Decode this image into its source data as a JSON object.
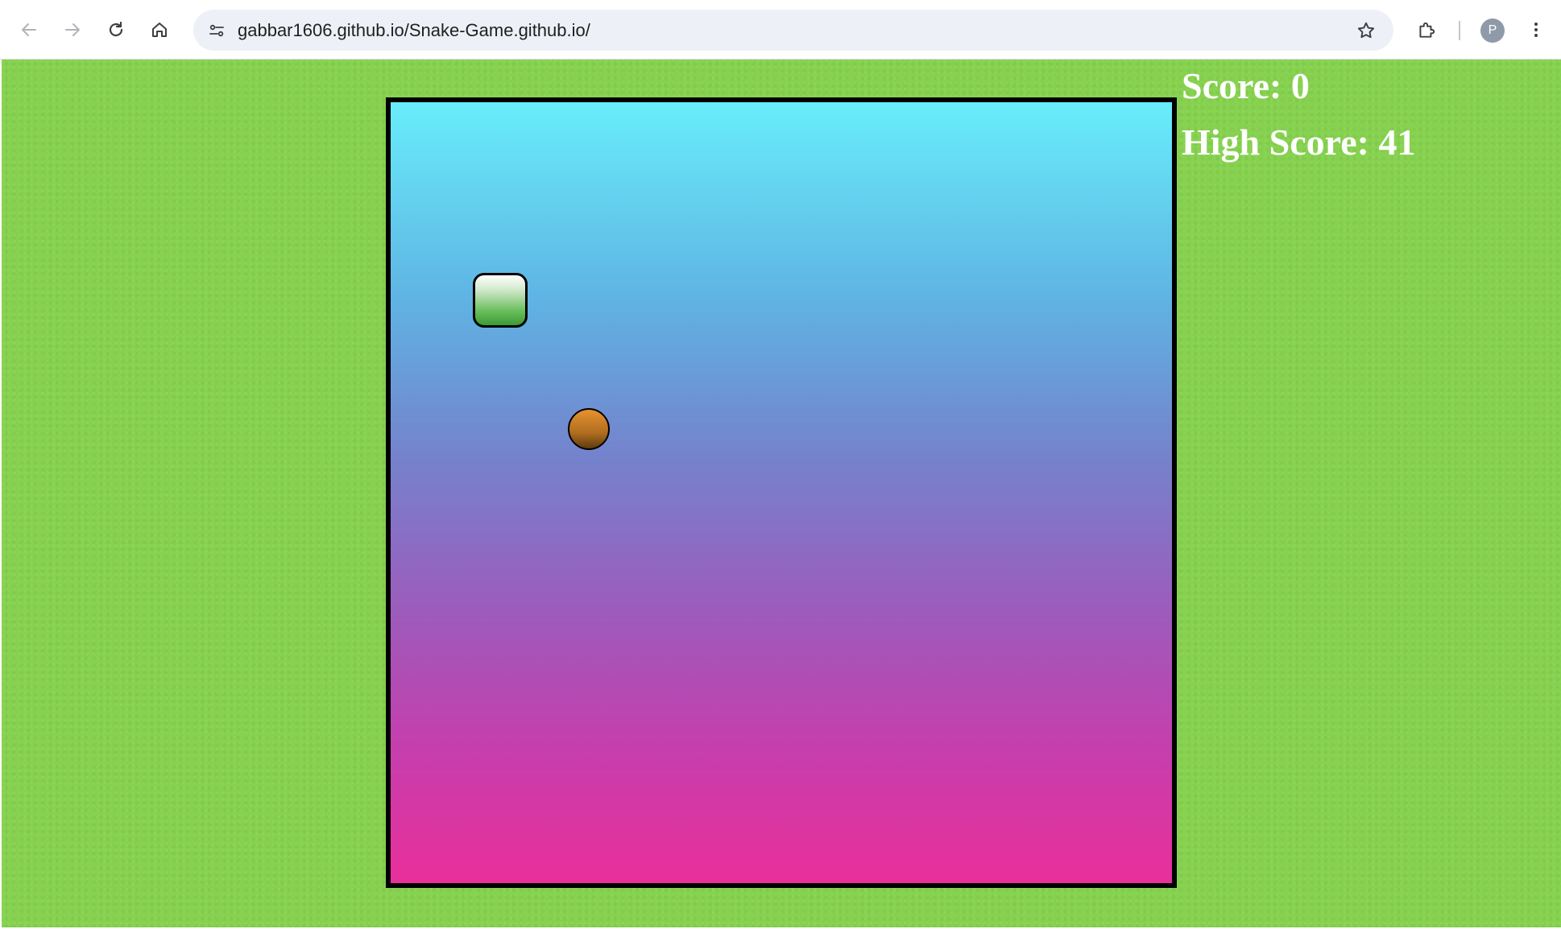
{
  "browser": {
    "url": "gabbar1606.github.io/Snake-Game.github.io/",
    "profile_initial": "P",
    "icons": [
      "back-arrow-icon",
      "forward-arrow-icon",
      "reload-icon",
      "home-icon",
      "site-settings-icon",
      "bookmark-star-icon",
      "extensions-puzzle-icon",
      "more-vert-icon"
    ]
  },
  "game": {
    "score_label": "Score: 0",
    "high_score_label": "High Score: 41",
    "score": 0,
    "high_score": 41,
    "colors": {
      "page_background": "#86d24f",
      "board_gradient_top": "#68edfb",
      "board_gradient_bottom": "#e92f9a",
      "board_border": "#000000",
      "snake": "#4caf3f",
      "food": "#c27a22",
      "score_text": "#ffffff"
    }
  }
}
